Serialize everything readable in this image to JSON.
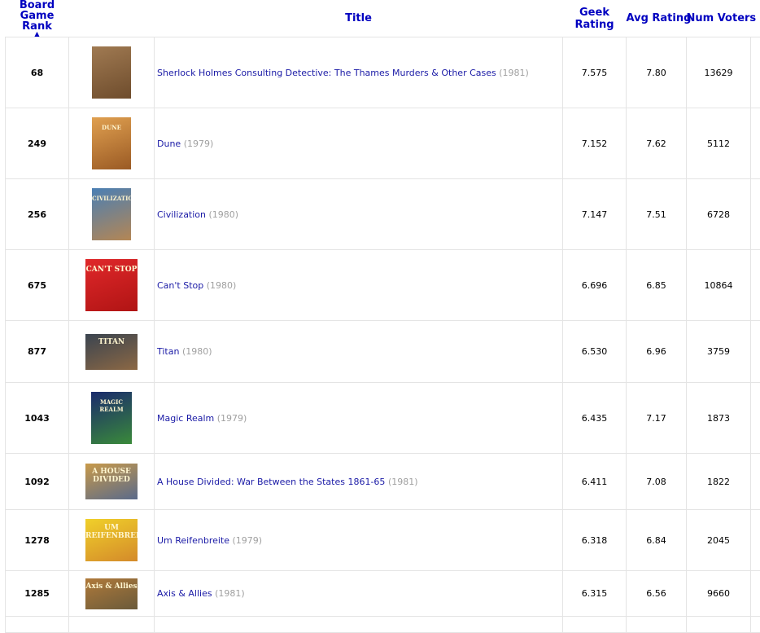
{
  "headers": {
    "rank_line1": "Board",
    "rank_line2": "Game Rank",
    "title": "Title",
    "geek_line1": "Geek",
    "geek_line2": "Rating",
    "avg": "Avg Rating",
    "voters": "Num Voters"
  },
  "rows": [
    {
      "rank": "68",
      "title": "Sherlock Holmes Consulting Detective: The Thames Murders & Other Cases",
      "year": "(1981)",
      "geek": "7.575",
      "avg": "7.80",
      "voters": "13629",
      "thumb": {
        "colors": [
          "#a07a52",
          "#6e4c2c"
        ],
        "caption": ""
      }
    },
    {
      "rank": "249",
      "title": "Dune",
      "year": "(1979)",
      "geek": "7.152",
      "avg": "7.62",
      "voters": "5112",
      "thumb": {
        "colors": [
          "#e0a050",
          "#9a5a24"
        ],
        "caption": "DUNE"
      }
    },
    {
      "rank": "256",
      "title": "Civilization",
      "year": "(1980)",
      "geek": "7.147",
      "avg": "7.51",
      "voters": "6728",
      "thumb": {
        "colors": [
          "#4a7fb4",
          "#b48654"
        ],
        "caption": "CIVILIZATION"
      }
    },
    {
      "rank": "675",
      "title": "Can't Stop",
      "year": "(1980)",
      "geek": "6.696",
      "avg": "6.85",
      "voters": "10864",
      "thumb": {
        "colors": [
          "#e0282a",
          "#b01414"
        ],
        "caption": "CAN'T STOP"
      }
    },
    {
      "rank": "877",
      "title": "Titan",
      "year": "(1980)",
      "geek": "6.530",
      "avg": "6.96",
      "voters": "3759",
      "thumb": {
        "colors": [
          "#3a4450",
          "#8c6844"
        ],
        "caption": "TITAN"
      }
    },
    {
      "rank": "1043",
      "title": "Magic Realm",
      "year": "(1979)",
      "geek": "6.435",
      "avg": "7.17",
      "voters": "1873",
      "thumb": {
        "colors": [
          "#1a2a6c",
          "#3a8a3a"
        ],
        "caption": "MAGIC REALM"
      }
    },
    {
      "rank": "1092",
      "title": "A House Divided: War Between the States 1861-65",
      "year": "(1981)",
      "geek": "6.411",
      "avg": "7.08",
      "voters": "1822",
      "thumb": {
        "colors": [
          "#c89a4a",
          "#5a6a8a"
        ],
        "caption": "A HOUSE DIVIDED"
      }
    },
    {
      "rank": "1278",
      "title": "Um Reifenbreite",
      "year": "(1979)",
      "geek": "6.318",
      "avg": "6.84",
      "voters": "2045",
      "thumb": {
        "colors": [
          "#f0d02a",
          "#d48a2a"
        ],
        "caption": "UM REIFENBREITE"
      }
    },
    {
      "rank": "1285",
      "title": "Axis & Allies",
      "year": "(1981)",
      "geek": "6.315",
      "avg": "6.56",
      "voters": "9660",
      "thumb": {
        "colors": [
          "#b07a3a",
          "#6a5a3a"
        ],
        "caption": "Axis & Allies"
      }
    }
  ]
}
